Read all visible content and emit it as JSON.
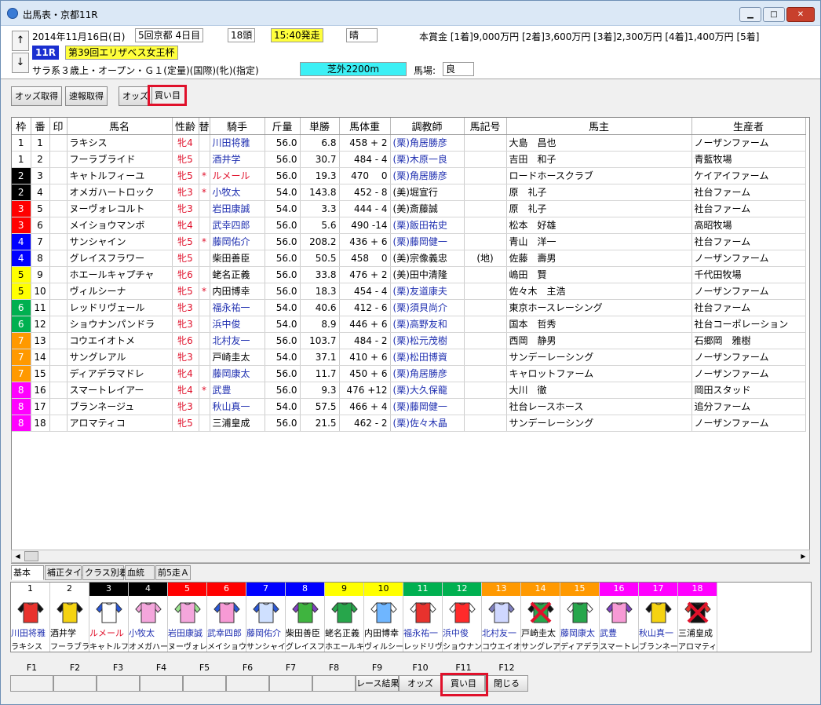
{
  "window": {
    "title": "出馬表・京都11R",
    "min": "▁",
    "max": "□",
    "close": "✕"
  },
  "race": {
    "date": "2014年11月16日(日)",
    "meet": "5回京都 4日目",
    "heads": "18頭",
    "start": "15:40発走",
    "weather": "晴",
    "num": "11R",
    "name": "第39回エリザベス女王杯",
    "cond": "サラ系３歳上・オープン・Ｇ１(定量)(国際)(牝)(指定)",
    "course": "芝外2200m",
    "going_label": "馬場:",
    "going": "良",
    "prize": "本賞金 [1着]9,000万円 [2着]3,600万円 [3着]2,300万円 [4着]1,400万円 [5着]",
    "up": "↑",
    "down": "↓"
  },
  "toolbar": {
    "odds_get": "オッズ取得",
    "quick_get": "速報取得",
    "odds": "オッズ",
    "buy": "買い目"
  },
  "columns": [
    "枠",
    "番",
    "印",
    "馬名",
    "性齢",
    "替",
    "騎手",
    "斤量",
    "単勝",
    "馬体重",
    "調教師",
    "馬記号",
    "馬主",
    "生産者"
  ],
  "colors": {
    "1": "#ffffff",
    "2": "#000000",
    "3": "#ff0000",
    "4": "#0000ff",
    "5": "#ffff00",
    "6": "#00b050",
    "7": "#ff9900",
    "8": "#ff00ff"
  },
  "rows": [
    {
      "w": "1",
      "n": "1",
      "horse": "ラキシス",
      "sa": "牝4",
      "sw": "",
      "jockey": "川田将雅",
      "wt": "56.0",
      "odds": "6.8",
      "bw": "458 + 2",
      "tr": "(栗)角居勝彦",
      "mk": "",
      "owner": "大島　昌也",
      "breeder": "ノーザンファーム"
    },
    {
      "w": "1",
      "n": "2",
      "horse": "フーラブライド",
      "sa": "牝5",
      "sw": "",
      "jockey": "酒井学",
      "wt": "56.0",
      "odds": "30.7",
      "bw": "484 - 4",
      "tr": "(栗)木原一良",
      "mk": "",
      "owner": "吉田　和子",
      "breeder": "青藍牧場"
    },
    {
      "w": "2",
      "n": "3",
      "horse": "キャトルフィーユ",
      "sa": "牝5",
      "sw": "*",
      "jockey": "ルメール",
      "wt": "56.0",
      "odds": "19.3",
      "bw": "470　 0",
      "tr": "(栗)角居勝彦",
      "mk": "",
      "owner": "ロードホースクラブ",
      "breeder": "ケイアイファーム"
    },
    {
      "w": "2",
      "n": "4",
      "horse": "オメガハートロック",
      "sa": "牝3",
      "sw": "*",
      "jockey": "小牧太",
      "wt": "54.0",
      "odds": "143.8",
      "bw": "452 - 8",
      "tr": "(美)堀宣行",
      "mk": "",
      "owner": "原　礼子",
      "breeder": "社台ファーム"
    },
    {
      "w": "3",
      "n": "5",
      "horse": "ヌーヴォレコルト",
      "sa": "牝3",
      "sw": "",
      "jockey": "岩田康誠",
      "wt": "54.0",
      "odds": "3.3",
      "bw": "444 - 4",
      "tr": "(美)斎藤誠",
      "mk": "",
      "owner": "原　礼子",
      "breeder": "社台ファーム"
    },
    {
      "w": "3",
      "n": "6",
      "horse": "メイショウマンボ",
      "sa": "牝4",
      "sw": "",
      "jockey": "武幸四郎",
      "wt": "56.0",
      "odds": "5.6",
      "bw": "490 -14",
      "tr": "(栗)飯田祐史",
      "mk": "",
      "owner": "松本　好雄",
      "breeder": "高昭牧場"
    },
    {
      "w": "4",
      "n": "7",
      "horse": "サンシャイン",
      "sa": "牝5",
      "sw": "*",
      "jockey": "藤岡佑介",
      "wt": "56.0",
      "odds": "208.2",
      "bw": "436 + 6",
      "tr": "(栗)藤岡健一",
      "mk": "",
      "owner": "青山　洋一",
      "breeder": "社台ファーム"
    },
    {
      "w": "4",
      "n": "8",
      "horse": "グレイスフラワー",
      "sa": "牝5",
      "sw": "",
      "jockey": "柴田善臣",
      "wt": "56.0",
      "odds": "50.5",
      "bw": "458　 0",
      "tr": "(美)宗像義忠",
      "mk": "(地)",
      "owner": "佐藤　壽男",
      "breeder": "ノーザンファーム"
    },
    {
      "w": "5",
      "n": "9",
      "horse": "ホエールキャプチャ",
      "sa": "牝6",
      "sw": "",
      "jockey": "蛯名正義",
      "wt": "56.0",
      "odds": "33.8",
      "bw": "476 + 2",
      "tr": "(美)田中清隆",
      "mk": "",
      "owner": "嶋田　賢",
      "breeder": "千代田牧場"
    },
    {
      "w": "5",
      "n": "10",
      "horse": "ヴィルシーナ",
      "sa": "牝5",
      "sw": "*",
      "jockey": "内田博幸",
      "wt": "56.0",
      "odds": "18.3",
      "bw": "454 - 4",
      "tr": "(栗)友道康夫",
      "mk": "",
      "owner": "佐々木　主浩",
      "breeder": "ノーザンファーム"
    },
    {
      "w": "6",
      "n": "11",
      "horse": "レッドリヴェール",
      "sa": "牝3",
      "sw": "",
      "jockey": "福永祐一",
      "wt": "54.0",
      "odds": "40.6",
      "bw": "412 - 6",
      "tr": "(栗)須貝尚介",
      "mk": "",
      "owner": "東京ホースレーシング",
      "breeder": "社台ファーム"
    },
    {
      "w": "6",
      "n": "12",
      "horse": "ショウナンパンドラ",
      "sa": "牝3",
      "sw": "",
      "jockey": "浜中俊",
      "wt": "54.0",
      "odds": "8.9",
      "bw": "446 + 6",
      "tr": "(栗)高野友和",
      "mk": "",
      "owner": "国本　哲秀",
      "breeder": "社台コーポレーション"
    },
    {
      "w": "7",
      "n": "13",
      "horse": "コウエイオトメ",
      "sa": "牝6",
      "sw": "",
      "jockey": "北村友一",
      "wt": "56.0",
      "odds": "103.7",
      "bw": "484 - 2",
      "tr": "(栗)松元茂樹",
      "mk": "",
      "owner": "西岡　静男",
      "breeder": "石郷岡　雅樹"
    },
    {
      "w": "7",
      "n": "14",
      "horse": "サングレアル",
      "sa": "牝3",
      "sw": "",
      "jockey": "戸崎圭太",
      "wt": "54.0",
      "odds": "37.1",
      "bw": "410 + 6",
      "tr": "(栗)松田博資",
      "mk": "",
      "owner": "サンデーレーシング",
      "breeder": "ノーザンファーム"
    },
    {
      "w": "7",
      "n": "15",
      "horse": "ディアデラマドレ",
      "sa": "牝4",
      "sw": "",
      "jockey": "藤岡康太",
      "wt": "56.0",
      "odds": "11.7",
      "bw": "450 + 6",
      "tr": "(栗)角居勝彦",
      "mk": "",
      "owner": "キャロットファーム",
      "breeder": "ノーザンファーム"
    },
    {
      "w": "8",
      "n": "16",
      "horse": "スマートレイアー",
      "sa": "牝4",
      "sw": "*",
      "jockey": "武豊",
      "wt": "56.0",
      "odds": "9.3",
      "bw": "476 +12",
      "tr": "(栗)大久保龍",
      "mk": "",
      "owner": "大川　徹",
      "breeder": "岡田スタッド"
    },
    {
      "w": "8",
      "n": "17",
      "horse": "ブランネージュ",
      "sa": "牝3",
      "sw": "",
      "jockey": "秋山真一",
      "wt": "54.0",
      "odds": "57.5",
      "bw": "466 + 4",
      "tr": "(栗)藤岡健一",
      "mk": "",
      "owner": "社台レースホース",
      "breeder": "追分ファーム"
    },
    {
      "w": "8",
      "n": "18",
      "horse": "アロマティコ",
      "sa": "牝5",
      "sw": "",
      "jockey": "三浦皇成",
      "wt": "56.0",
      "odds": "21.5",
      "bw": "462 - 2",
      "tr": "(栗)佐々木晶",
      "mk": "",
      "owner": "サンデーレーシング",
      "breeder": "ノーザンファーム"
    }
  ],
  "tabs": [
    "基本",
    "補正タイム",
    "クラス別着",
    "血統",
    "前5走Ａ"
  ],
  "silks": [
    {
      "n": "1",
      "bg": "#ffffff",
      "fg": "#000",
      "jk": "川田将雅",
      "hs": "ラキシス",
      "body": "#e8322d",
      "sl": "#111",
      "x": false
    },
    {
      "n": "2",
      "bg": "#ffffff",
      "fg": "#000",
      "jk": "酒井学",
      "hs": "フーラブライド",
      "body": "#f5d312",
      "sl": "#111",
      "x": false
    },
    {
      "n": "3",
      "bg": "#000000",
      "fg": "#fff",
      "jk": "ルメール",
      "hs": "キャトルフィーユ",
      "body": "#ffffff",
      "sl": "#2a57d6",
      "x": false
    },
    {
      "n": "4",
      "bg": "#000000",
      "fg": "#fff",
      "jk": "小牧太",
      "hs": "オメガハートロック",
      "body": "#f4a6dc",
      "sl": "#f4a6dc",
      "x": false
    },
    {
      "n": "5",
      "bg": "#ff0000",
      "fg": "#fff",
      "jk": "岩田康誠",
      "hs": "ヌーヴォレコルト",
      "body": "#f4a6dc",
      "sl": "#9be38f",
      "x": false
    },
    {
      "n": "6",
      "bg": "#ff0000",
      "fg": "#fff",
      "jk": "武幸四郎",
      "hs": "メイショウマンボ",
      "body": "#f79ad5",
      "sl": "#2a57d6",
      "x": false
    },
    {
      "n": "7",
      "bg": "#0000ff",
      "fg": "#fff",
      "jk": "藤岡佑介",
      "hs": "サンシャイン",
      "body": "#cfe0ff",
      "sl": "#2a57d6",
      "x": false
    },
    {
      "n": "8",
      "bg": "#0000ff",
      "fg": "#fff",
      "jk": "柴田善臣",
      "hs": "グレイスフラワー",
      "body": "#3fb43f",
      "sl": "#7f3fbf",
      "x": false
    },
    {
      "n": "9",
      "bg": "#ffff00",
      "fg": "#000",
      "jk": "蛯名正義",
      "hs": "ホエールキャプチャ",
      "body": "#27a64b",
      "sl": "#27a64b",
      "x": false
    },
    {
      "n": "10",
      "bg": "#ffff00",
      "fg": "#000",
      "jk": "内田博幸",
      "hs": "ヴィルシーナ",
      "body": "#6fb6ff",
      "sl": "#ffffff",
      "x": false
    },
    {
      "n": "11",
      "bg": "#00b050",
      "fg": "#fff",
      "jk": "福永祐一",
      "hs": "レッドリヴェール",
      "body": "#e8322d",
      "sl": "#ffffff",
      "x": false
    },
    {
      "n": "12",
      "bg": "#00b050",
      "fg": "#fff",
      "jk": "浜中俊",
      "hs": "ショウナンパンドラ",
      "body": "#ff2a2a",
      "sl": "#ffffff",
      "x": false
    },
    {
      "n": "13",
      "bg": "#ff9900",
      "fg": "#fff",
      "jk": "北村友一",
      "hs": "コウエイオトメ",
      "body": "#cfd7ff",
      "sl": "#7f7fbf",
      "x": false
    },
    {
      "n": "14",
      "bg": "#ff9900",
      "fg": "#fff",
      "jk": "戸崎圭太",
      "hs": "サングレアル",
      "body": "#27a64b",
      "sl": "#111",
      "x": true
    },
    {
      "n": "15",
      "bg": "#ff9900",
      "fg": "#fff",
      "jk": "藤岡康太",
      "hs": "ディアデラマドレ",
      "body": "#27a64b",
      "sl": "#ffffff",
      "x": false
    },
    {
      "n": "16",
      "bg": "#ff00ff",
      "fg": "#fff",
      "jk": "武豊",
      "hs": "スマートレイアー",
      "body": "#f79ad5",
      "sl": "#7f3fbf",
      "x": false
    },
    {
      "n": "17",
      "bg": "#ff00ff",
      "fg": "#fff",
      "jk": "秋山真一",
      "hs": "ブランネージュ",
      "body": "#f5d312",
      "sl": "#111",
      "x": false
    },
    {
      "n": "18",
      "bg": "#ff00ff",
      "fg": "#fff",
      "jk": "三浦皇成",
      "hs": "アロマティコ",
      "body": "#111111",
      "sl": "#e8322d",
      "x": true
    }
  ],
  "fkeys": [
    {
      "k": "F1",
      "label": ""
    },
    {
      "k": "F2",
      "label": ""
    },
    {
      "k": "F3",
      "label": ""
    },
    {
      "k": "F4",
      "label": ""
    },
    {
      "k": "F5",
      "label": ""
    },
    {
      "k": "F6",
      "label": ""
    },
    {
      "k": "F7",
      "label": ""
    },
    {
      "k": "F8",
      "label": ""
    },
    {
      "k": "F9",
      "label": "レース結果"
    },
    {
      "k": "F10",
      "label": "オッズ"
    },
    {
      "k": "F11",
      "label": "買い目"
    },
    {
      "k": "F12",
      "label": "閉じる"
    }
  ]
}
